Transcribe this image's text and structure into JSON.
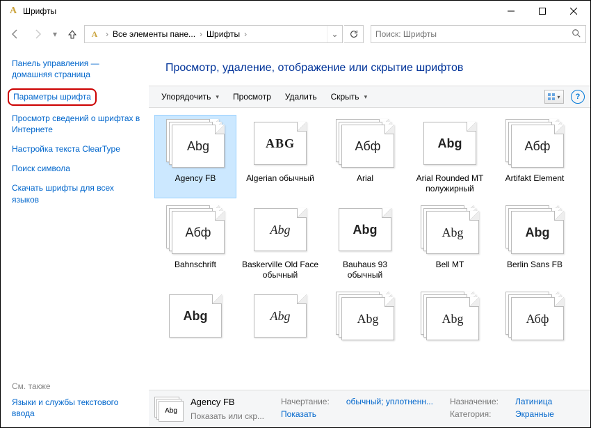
{
  "window": {
    "title": "Шрифты"
  },
  "nav": {
    "crumb1": "Все элементы пане...",
    "crumb2": "Шрифты"
  },
  "search": {
    "placeholder": "Поиск: Шрифты"
  },
  "sidebar": {
    "home": "Панель управления — домашняя страница",
    "highlighted": "Параметры шрифта",
    "l2": "Просмотр сведений о шрифтах в Интернете",
    "l3": "Настройка текста ClearType",
    "l4": "Поиск символа",
    "l5": "Скачать шрифты для всех языков",
    "see_also_label": "См. также",
    "see_also": "Языки и службы текстового ввода"
  },
  "heading": "Просмотр, удаление, отображение или скрытие шрифтов",
  "toolbar": {
    "organize": "Упорядочить",
    "preview": "Просмотр",
    "delete": "Удалить",
    "hide": "Скрыть"
  },
  "fonts": [
    {
      "label": "Agency FB",
      "sample": "Abg",
      "cls": "sf-agency",
      "stack": true,
      "selected": true
    },
    {
      "label": "Algerian обычный",
      "sample": "ABG",
      "cls": "sf-algerian",
      "stack": false
    },
    {
      "label": "Arial",
      "sample": "Абф",
      "cls": "sf-arial",
      "stack": true
    },
    {
      "label": "Arial Rounded MT полужирный",
      "sample": "Abg",
      "cls": "sf-arialround",
      "stack": false
    },
    {
      "label": "Artifakt Element",
      "sample": "Абф",
      "cls": "sf-artifakt",
      "stack": true
    },
    {
      "label": "Bahnschrift",
      "sample": "Абф",
      "cls": "sf-bahn",
      "stack": true
    },
    {
      "label": "Baskerville Old Face обычный",
      "sample": "Abg",
      "cls": "sf-baskerville",
      "stack": false
    },
    {
      "label": "Bauhaus 93 обычный",
      "sample": "Abg",
      "cls": "sf-bauhaus",
      "stack": false
    },
    {
      "label": "Bell MT",
      "sample": "Abg",
      "cls": "sf-bellmt",
      "stack": true
    },
    {
      "label": "Berlin Sans FB",
      "sample": "Abg",
      "cls": "sf-berlinsans",
      "stack": true
    },
    {
      "label": "",
      "sample": "Abg",
      "cls": "sf-bernard",
      "stack": false
    },
    {
      "label": "",
      "sample": "Abg",
      "cls": "sf-blackadder",
      "stack": false
    },
    {
      "label": "",
      "sample": "Abg",
      "cls": "sf-bodoni",
      "stack": true
    },
    {
      "label": "",
      "sample": "Abg",
      "cls": "sf-bodonicond",
      "stack": true
    },
    {
      "label": "",
      "sample": "Абф",
      "cls": "sf-bodonipost",
      "stack": true
    }
  ],
  "status": {
    "thumb_sample": "Abg",
    "name": "Agency FB",
    "show_hide_label": "Показать или скр...",
    "style_label": "Начертание:",
    "style_value": "обычный; уплотненн...",
    "show_value": "Показать",
    "designed_label": "Назначение:",
    "designed_value": "Латиница",
    "category_label": "Категория:",
    "category_value": "Экранные"
  }
}
